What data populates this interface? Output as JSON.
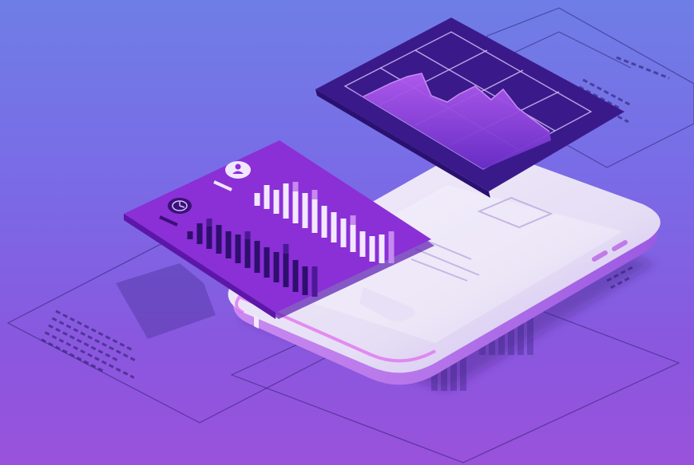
{
  "colors": {
    "background_top": "#6f7ee6",
    "background_bottom": "#9a52dc",
    "panel_purple": "#8b2fd6",
    "panel_dark": "#3c1a86",
    "phone_light": "#e9e2f6",
    "accent_pink": "#e066f0"
  },
  "icons": {
    "user": "user-icon",
    "clock": "clock-icon"
  }
}
